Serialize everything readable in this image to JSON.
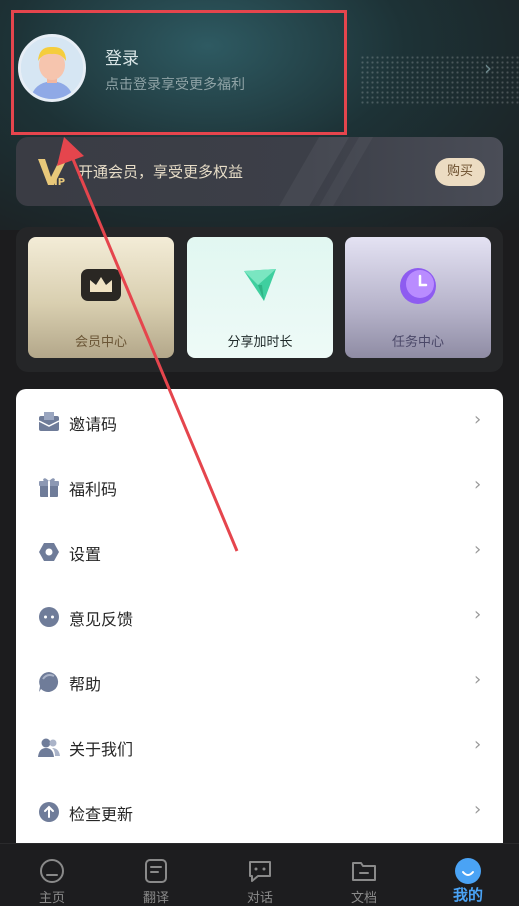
{
  "profile": {
    "login_title": "登录",
    "login_subtitle": "点击登录享受更多福利"
  },
  "vip": {
    "text": "开通会员，享受更多权益",
    "buy_label": "购买"
  },
  "cards": [
    {
      "label": "会员中心",
      "icon": "crown-icon"
    },
    {
      "label": "分享加时长",
      "icon": "share-plane-icon"
    },
    {
      "label": "任务中心",
      "icon": "clock-icon"
    }
  ],
  "menu": [
    {
      "label": "邀请码",
      "icon": "invite-envelope-icon"
    },
    {
      "label": "福利码",
      "icon": "gift-icon"
    },
    {
      "label": "设置",
      "icon": "settings-hex-icon"
    },
    {
      "label": "意见反馈",
      "icon": "feedback-chat-icon"
    },
    {
      "label": "帮助",
      "icon": "help-bubble-icon"
    },
    {
      "label": "关于我们",
      "icon": "about-users-icon"
    },
    {
      "label": "检查更新",
      "icon": "update-arrow-icon"
    }
  ],
  "tabs": [
    {
      "label": "主页",
      "icon": "home-icon",
      "active": false
    },
    {
      "label": "翻译",
      "icon": "translate-doc-icon",
      "active": false
    },
    {
      "label": "对话",
      "icon": "chat-icon",
      "active": false
    },
    {
      "label": "文档",
      "icon": "folder-icon",
      "active": false
    },
    {
      "label": "我的",
      "icon": "profile-smile-icon",
      "active": true
    }
  ],
  "colors": {
    "accent": "#4aa3f5",
    "annotation_red": "#e5454d",
    "vip_gold": "#ecdcc2"
  }
}
